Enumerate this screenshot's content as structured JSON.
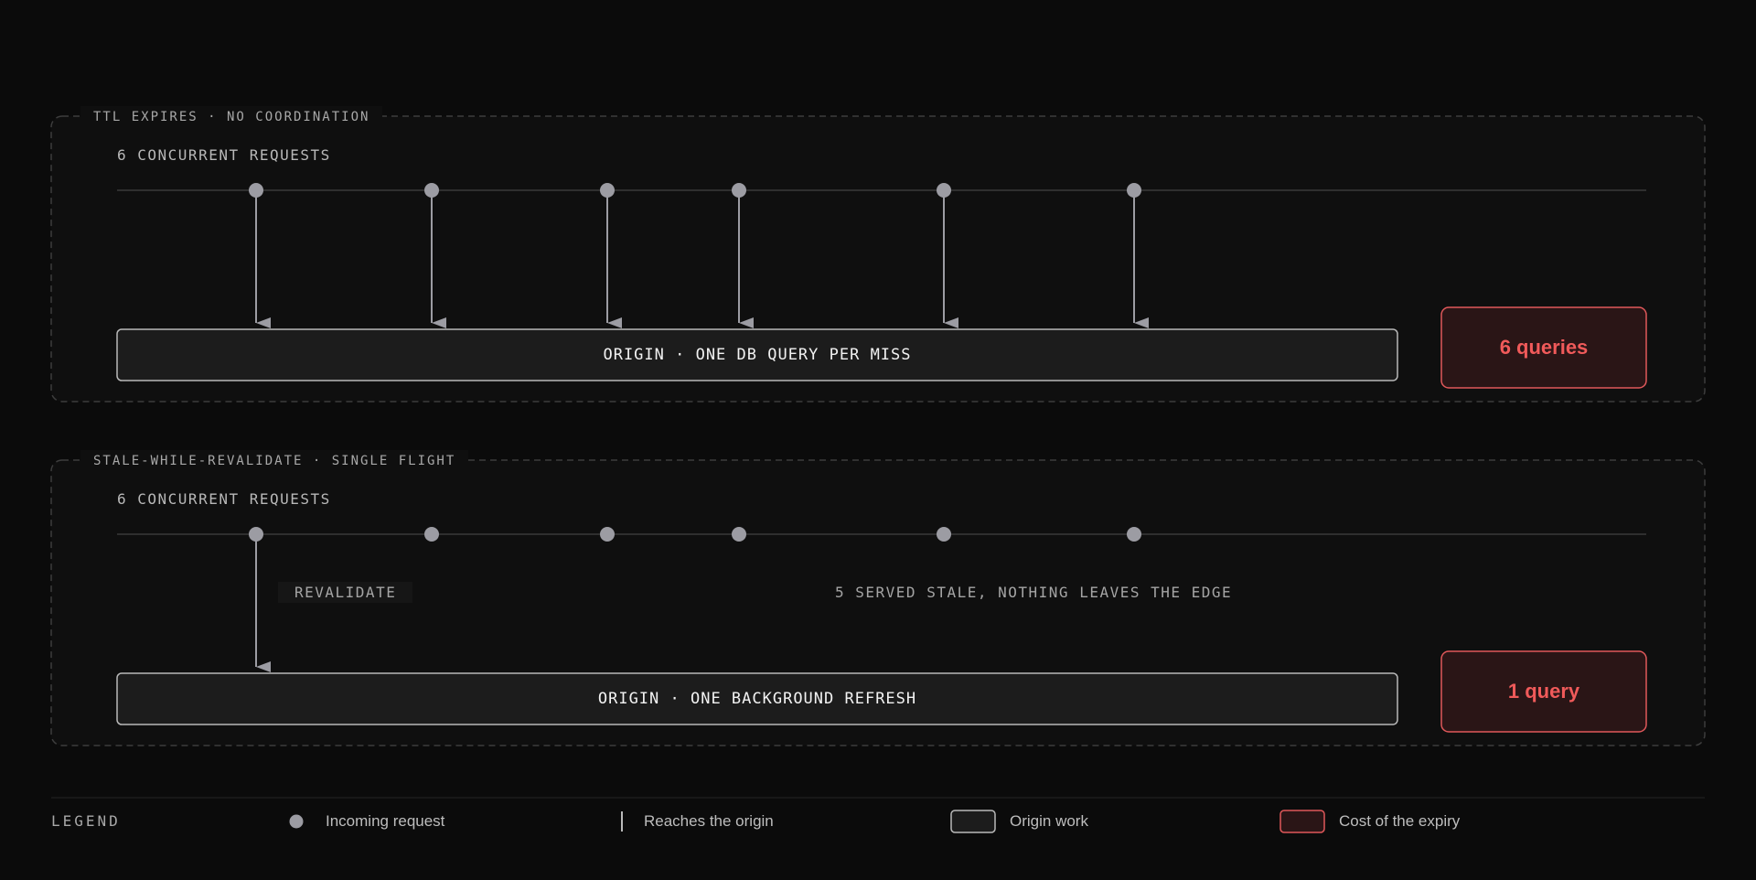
{
  "panels": [
    {
      "title": "TTL EXPIRES · NO COORDINATION",
      "requests_label": "6 CONCURRENT REQUESTS",
      "origin_label": "ORIGIN · ONE DB QUERY PER MISS",
      "cost_label": "6 queries"
    },
    {
      "title": "STALE-WHILE-REVALIDATE · SINGLE FLIGHT",
      "requests_label": "6 CONCURRENT REQUESTS",
      "origin_label": "ORIGIN · ONE BACKGROUND REFRESH",
      "cost_label": "1 query",
      "revalidate_label": "REVALIDATE",
      "stale_note": "5 SERVED STALE, NOTHING LEAVES THE EDGE"
    }
  ],
  "legend": {
    "title": "LEGEND",
    "items": [
      {
        "icon": "request-dot-icon",
        "label": "Incoming request"
      },
      {
        "icon": "origin-line-icon",
        "label": "Reaches the origin"
      },
      {
        "icon": "origin-box-icon",
        "label": "Origin work"
      },
      {
        "icon": "cost-box-icon",
        "label": "Cost of the expiry"
      }
    ]
  },
  "colors": {
    "background": "#0b0b0b",
    "panel": "#0f0f0f",
    "node": "#9c9ca3",
    "origin_fill": "#1c1c1c",
    "origin_stroke": "#b9b9b9",
    "cost_fill": "#2a1516",
    "cost_stroke": "#e0585a",
    "cost_text": "#f05a5a"
  }
}
